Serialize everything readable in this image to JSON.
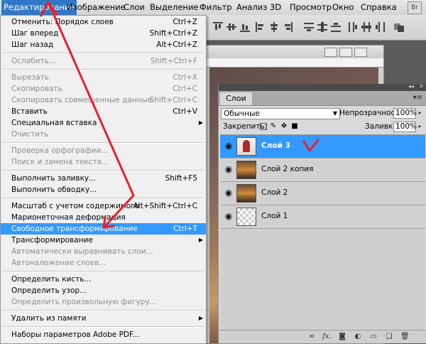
{
  "menubar": {
    "items": [
      {
        "label": "Редактирование",
        "active": true
      },
      {
        "label": "Изображение"
      },
      {
        "label": "Слои"
      },
      {
        "label": "Выделение"
      },
      {
        "label": "Фильтр"
      },
      {
        "label": "Анализ"
      },
      {
        "label": "3D"
      },
      {
        "label": "Просмотр"
      },
      {
        "label": "Окно"
      },
      {
        "label": "Справка"
      }
    ],
    "br_label": "Br"
  },
  "edit_menu": {
    "items": [
      {
        "label": "Отменить: Порядок слоев",
        "shortcut": "Ctrl+Z"
      },
      {
        "label": "Шаг вперед",
        "shortcut": "Shift+Ctrl+Z"
      },
      {
        "label": "Шаг назад",
        "shortcut": "Alt+Ctrl+Z"
      },
      {
        "label": "Ослабить...",
        "shortcut": "Shift+Ctrl+F",
        "disabled": true
      },
      {
        "label": "Вырезать",
        "shortcut": "Ctrl+X",
        "disabled": true
      },
      {
        "label": "Скопировать",
        "shortcut": "Ctrl+C",
        "disabled": true
      },
      {
        "label": "Скопировать совмещенные данные",
        "shortcut": "Shift+Ctrl+C",
        "disabled": true
      },
      {
        "label": "Вставить",
        "shortcut": "Ctrl+V"
      },
      {
        "label": "Специальная вставка",
        "shortcut": "",
        "submenu": true
      },
      {
        "label": "Очистить",
        "shortcut": "",
        "disabled": true
      },
      {
        "label": "Проверка орфографии...",
        "shortcut": "",
        "disabled": true
      },
      {
        "label": "Поиск и замена текста...",
        "shortcut": "",
        "disabled": true
      },
      {
        "label": "Выполнить заливку...",
        "shortcut": "Shift+F5"
      },
      {
        "label": "Выполнить обводку...",
        "shortcut": ""
      },
      {
        "label": "Масштаб с учетом содержимого",
        "shortcut": "Alt+Shift+Ctrl+C"
      },
      {
        "label": "Марионеточная деформация",
        "shortcut": ""
      },
      {
        "label": "Свободное трансформирование",
        "shortcut": "Ctrl+T",
        "highlighted": true
      },
      {
        "label": "Трансформирование",
        "shortcut": "",
        "submenu": true
      },
      {
        "label": "Автоматически выравнивать слои...",
        "shortcut": "",
        "disabled": true
      },
      {
        "label": "Автоналожение слоев...",
        "shortcut": "",
        "disabled": true
      },
      {
        "label": "Определить кисть...",
        "shortcut": ""
      },
      {
        "label": "Определить узор...",
        "shortcut": ""
      },
      {
        "label": "Определить произвольную фигуру...",
        "shortcut": "",
        "disabled": true
      },
      {
        "label": "Удалить из памяти",
        "shortcut": "",
        "submenu": true
      },
      {
        "label": "Наборы параметров Adobe PDF...",
        "shortcut": ""
      }
    ]
  },
  "layers_panel": {
    "tab": "Слои",
    "blend_mode": "Обычные",
    "opacity_label": "Непрозрачность:",
    "opacity_value": "100%",
    "lock_label": "Закрепить:",
    "fill_label": "Заливка:",
    "fill_value": "100%",
    "layers": [
      {
        "name": "Слой 3",
        "selected": true
      },
      {
        "name": "Слой 2 копия"
      },
      {
        "name": "Слой 2"
      },
      {
        "name": "Слой 1"
      }
    ]
  },
  "colors": {
    "highlight": "#3399ff",
    "arrow": "#e8202a"
  }
}
